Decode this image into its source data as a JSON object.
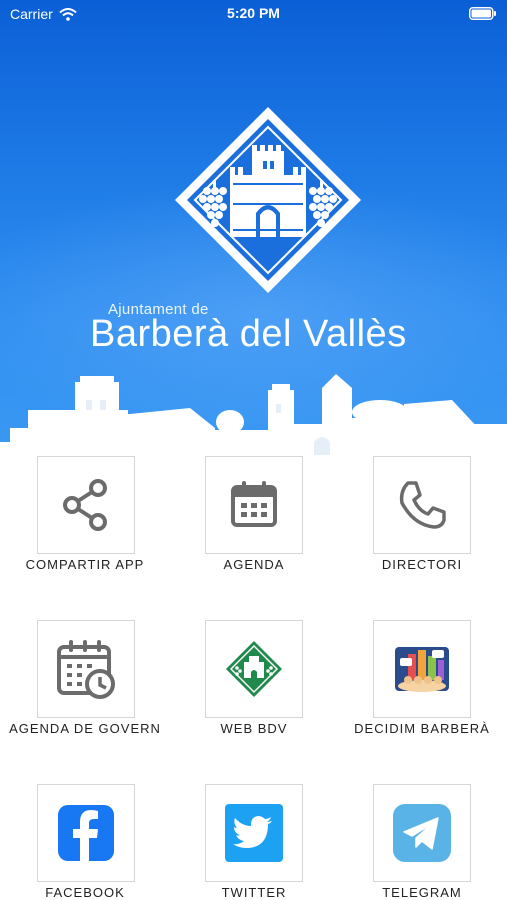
{
  "status_bar": {
    "carrier": "Carrier",
    "time": "5:20 PM",
    "wifi_icon": "wifi-icon",
    "battery_icon": "battery-icon"
  },
  "header": {
    "subtitle": "Ajuntament de",
    "title": "Barberà del Vallès",
    "crest_icon": "municipal-crest-icon",
    "background_color": "#1e7be6"
  },
  "menu": {
    "items": [
      {
        "label": "COMPARTIR APP",
        "icon": "share-icon"
      },
      {
        "label": "AGENDA",
        "icon": "calendar-icon"
      },
      {
        "label": "DIRECTORI",
        "icon": "phone-icon"
      },
      {
        "label": "AGENDA DE GOVERN",
        "icon": "calendar-clock-icon"
      },
      {
        "label": "WEB BDV",
        "icon": "crest-green-icon"
      },
      {
        "label": "DECIDIM BARBERÀ",
        "icon": "decidim-icon"
      },
      {
        "label": "FACEBOOK",
        "icon": "facebook-icon"
      },
      {
        "label": "TWITTER",
        "icon": "twitter-icon"
      },
      {
        "label": "TELEGRAM",
        "icon": "telegram-icon"
      }
    ]
  },
  "colors": {
    "icon_gray": "#6b6b6b",
    "facebook": "#1877f2",
    "twitter": "#1da1f2",
    "telegram": "#5ab3e6",
    "web_green": "#1f8a4c"
  }
}
